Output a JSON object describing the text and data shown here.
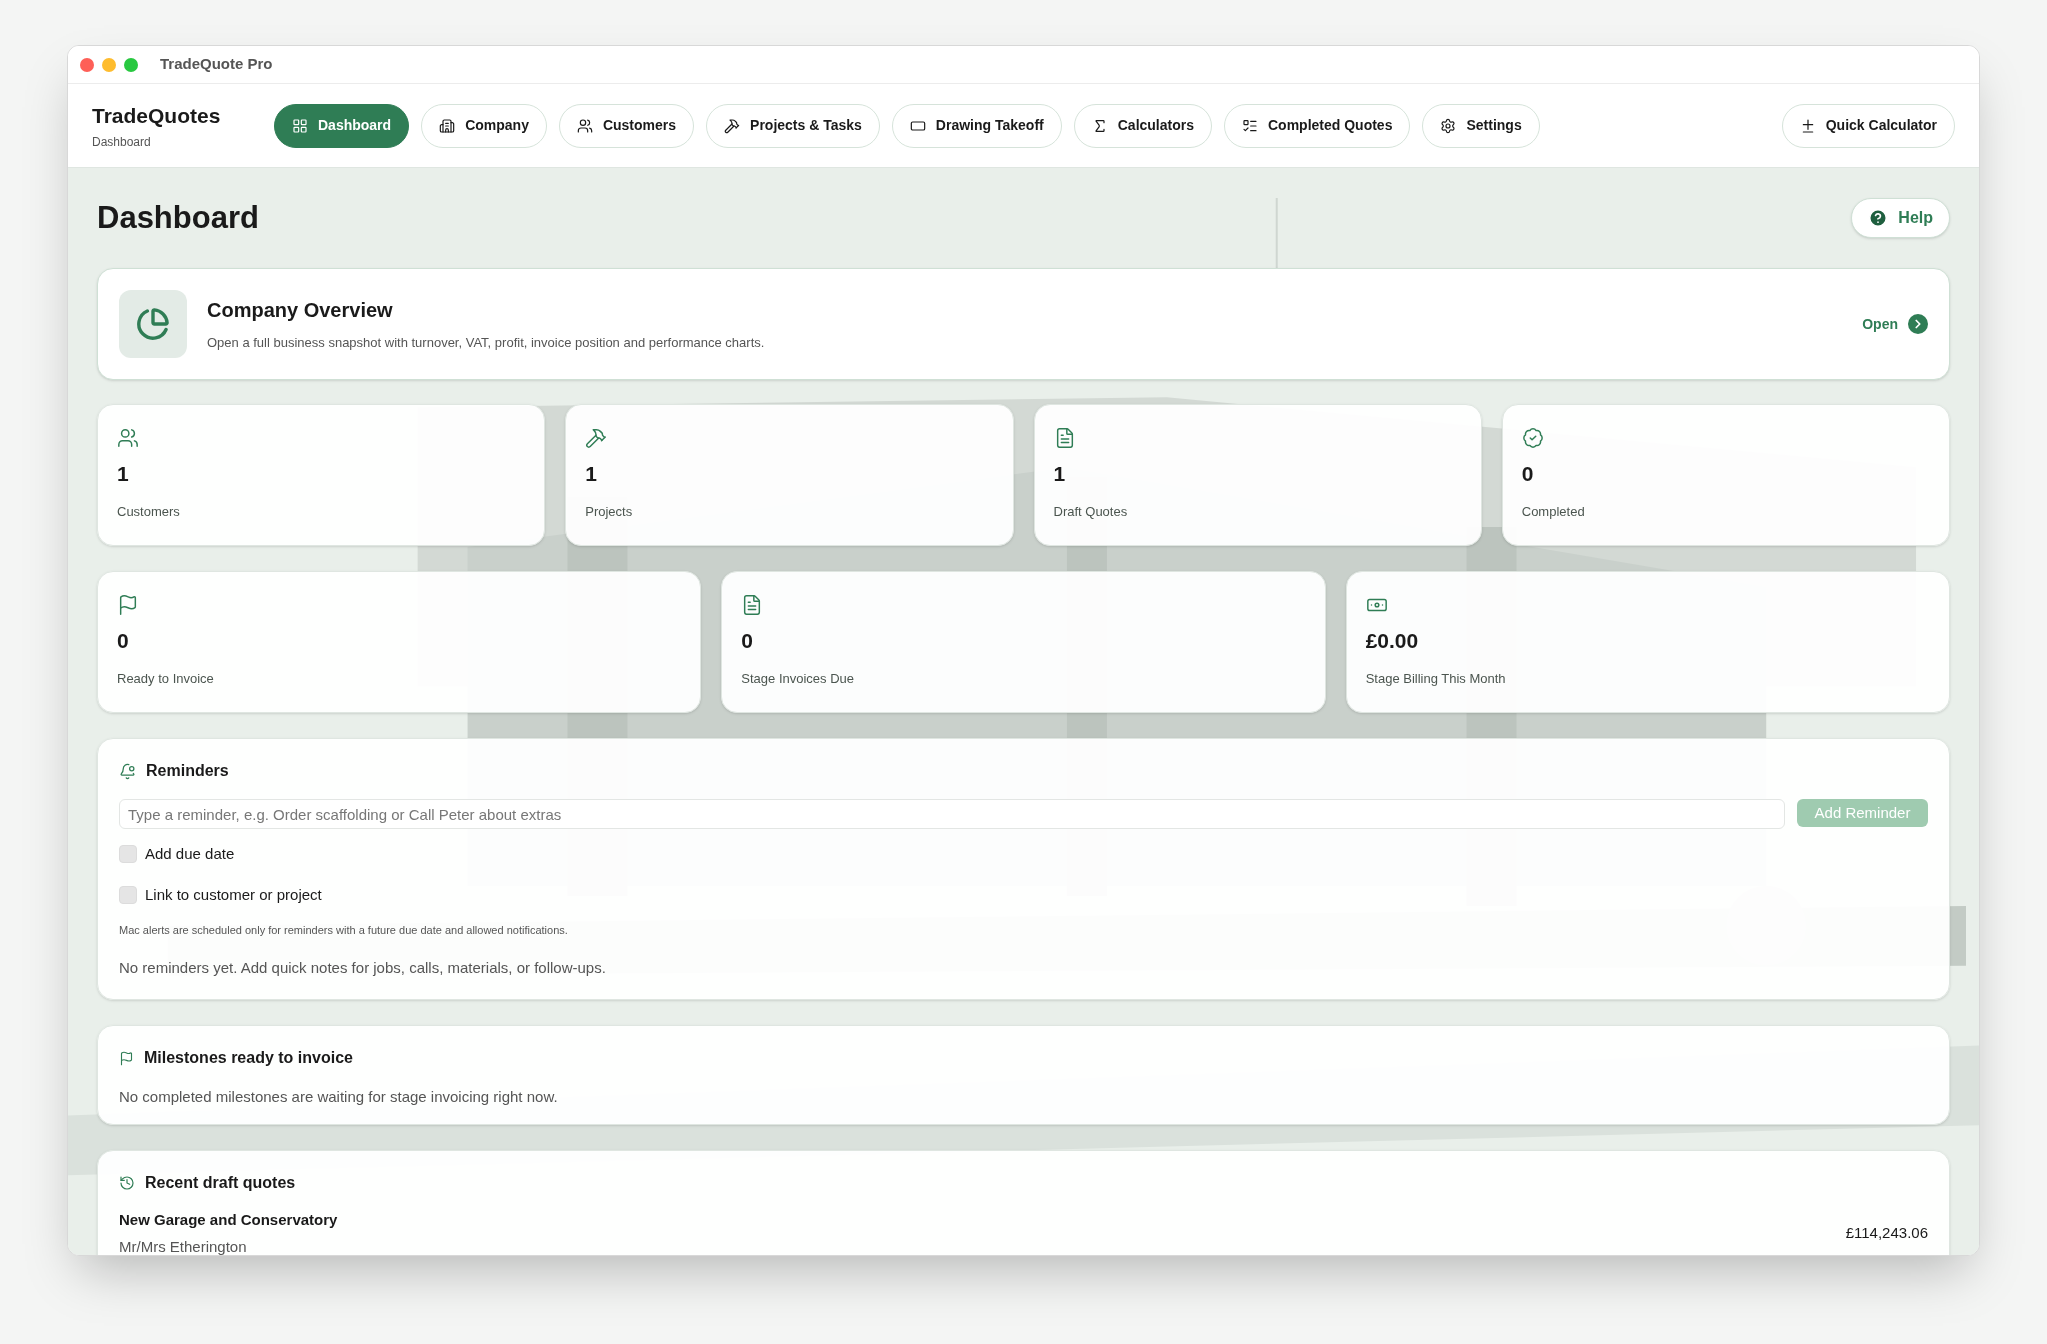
{
  "window": {
    "title": "TradeQuote Pro"
  },
  "brand": {
    "name": "TradeQuotes",
    "subtitle": "Dashboard"
  },
  "nav": [
    {
      "label": "Dashboard",
      "selected": true
    },
    {
      "label": "Company",
      "selected": false
    },
    {
      "label": "Customers",
      "selected": false
    },
    {
      "label": "Projects & Tasks",
      "selected": false
    },
    {
      "label": "Drawing Takeoff",
      "selected": false
    },
    {
      "label": "Calculators",
      "selected": false
    },
    {
      "label": "Completed Quotes",
      "selected": false
    },
    {
      "label": "Settings",
      "selected": false
    }
  ],
  "quick_calculator": "Quick Calculator",
  "page_title": "Dashboard",
  "help": "Help",
  "overview": {
    "title": "Company Overview",
    "description": "Open a full business snapshot with turnover, VAT, profit, invoice position and performance charts.",
    "action": "Open"
  },
  "stats_row_1": [
    {
      "value": "1",
      "label": "Customers"
    },
    {
      "value": "1",
      "label": "Projects"
    },
    {
      "value": "1",
      "label": "Draft Quotes"
    },
    {
      "value": "0",
      "label": "Completed"
    }
  ],
  "stats_row_2": [
    {
      "value": "0",
      "label": "Ready to Invoice"
    },
    {
      "value": "0",
      "label": "Stage Invoices Due"
    },
    {
      "value": "£0.00",
      "label": "Stage Billing This Month"
    }
  ],
  "reminders": {
    "title": "Reminders",
    "placeholder": "Type a reminder, e.g. Order scaffolding or Call Peter about extras",
    "add_button": {
      "label": "Add Reminder",
      "disabled": true
    },
    "options": [
      {
        "label": "Add due date",
        "checked": false
      },
      {
        "label": "Link to customer or project",
        "checked": false
      }
    ],
    "note": "Mac alerts are scheduled only for reminders with a future due date and allowed notifications.",
    "empty": "No reminders yet. Add quick notes for jobs, calls, materials, or follow-ups."
  },
  "milestones": {
    "title": "Milestones ready to invoice",
    "empty": "No completed milestones are waiting for stage invoicing right now."
  },
  "recent": {
    "title": "Recent draft quotes",
    "quotes": [
      {
        "title": "New Garage and Conservatory",
        "customer": "Mr/Mrs Etherington",
        "amount": "£114,243.06"
      }
    ]
  }
}
